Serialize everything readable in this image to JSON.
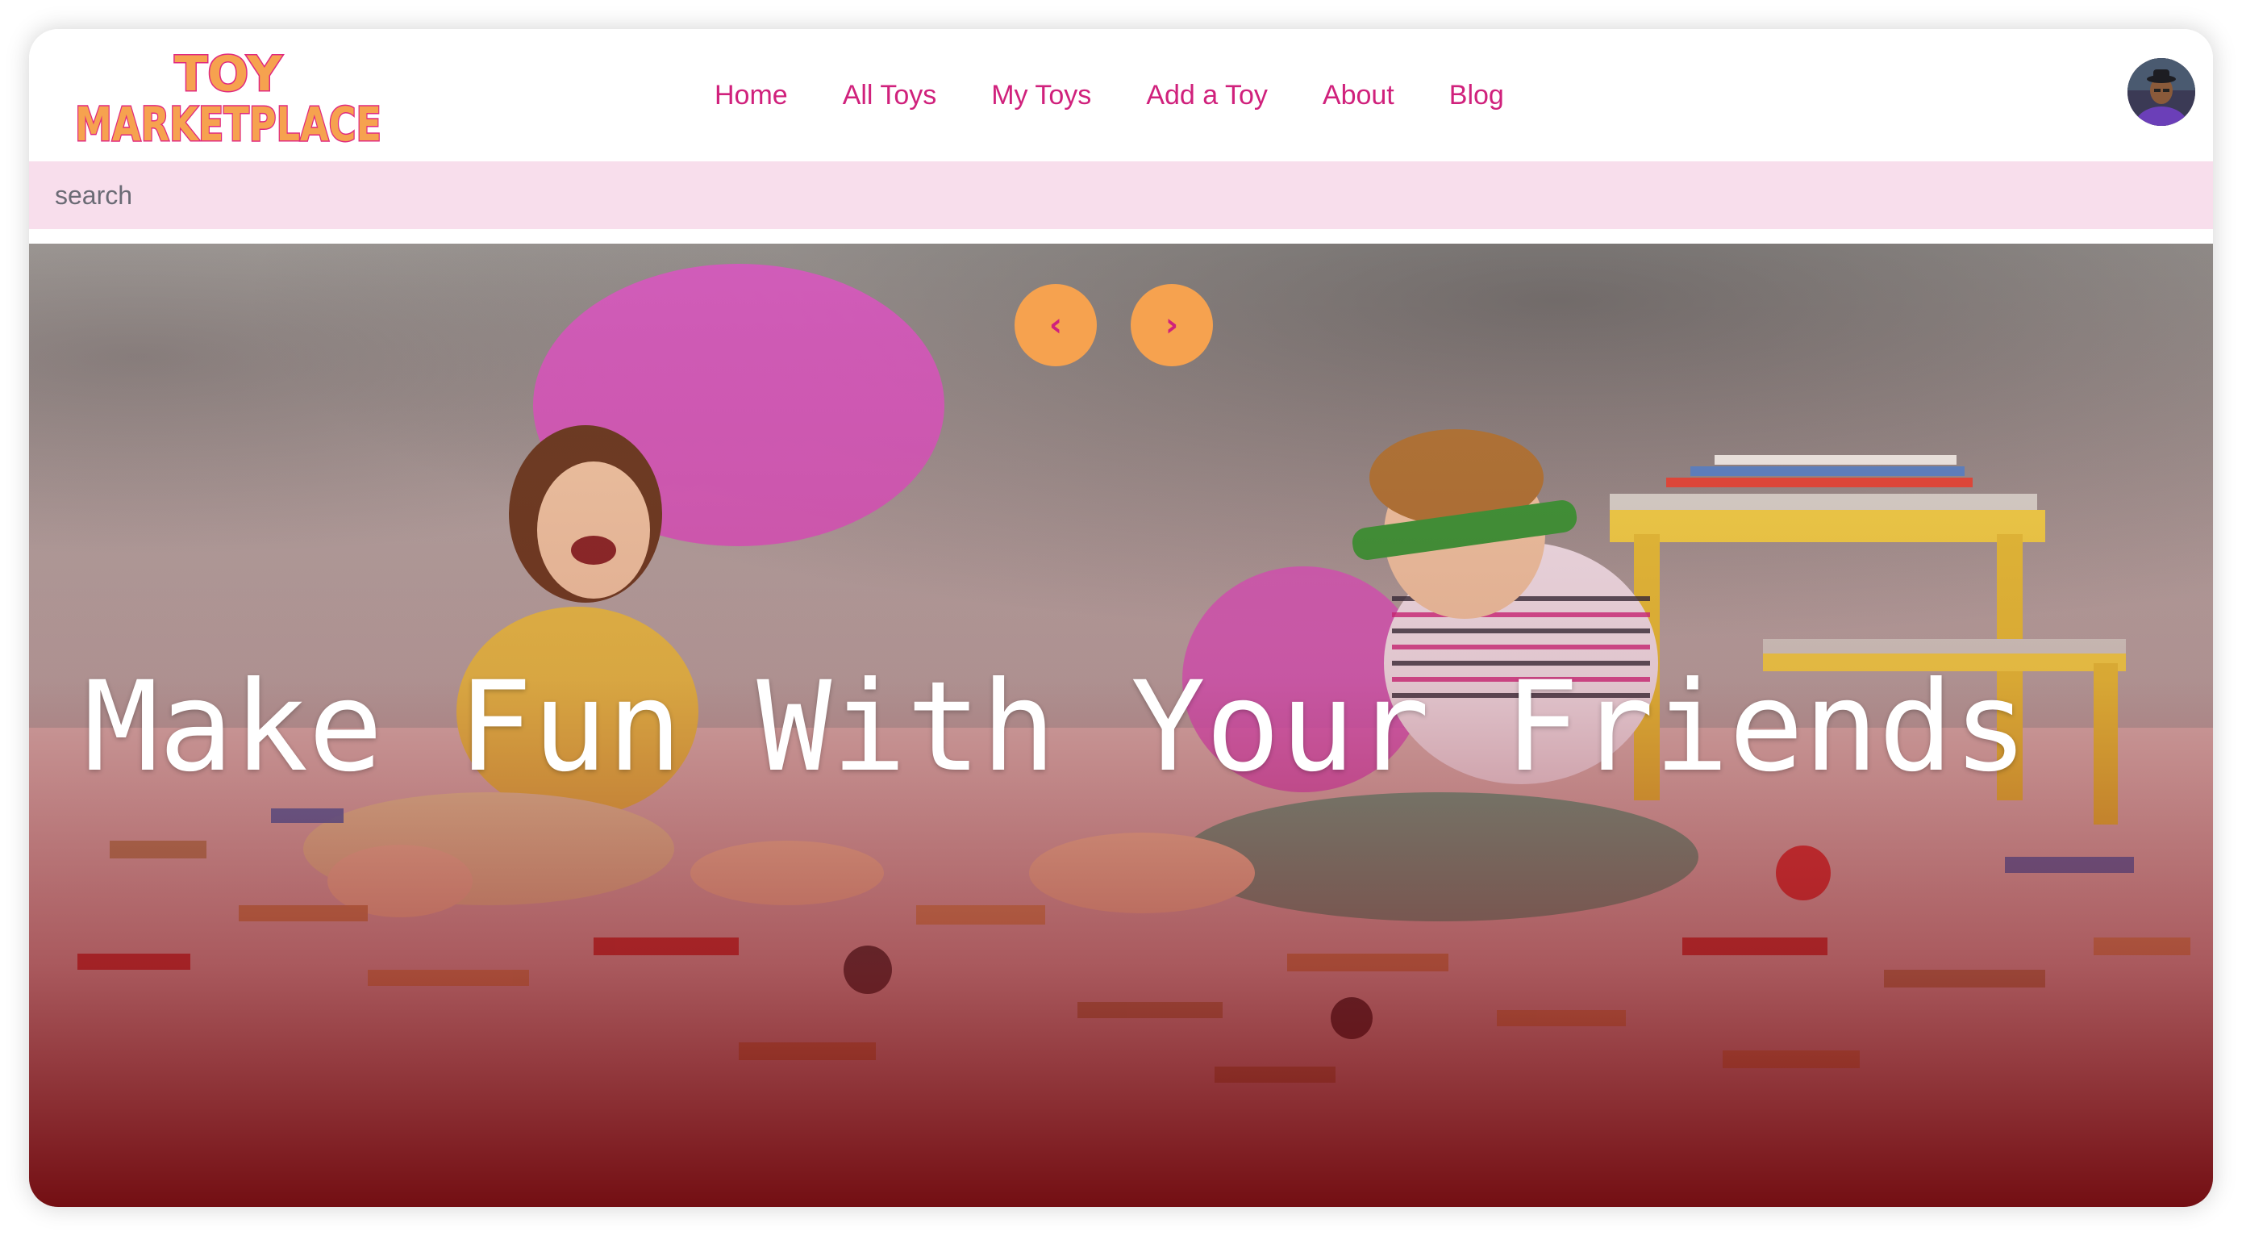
{
  "logo": {
    "line1": "TOY",
    "line2": "MARKETPLACE",
    "colors": {
      "fill": "#f6a24f",
      "outline": "#e0287f"
    }
  },
  "nav": {
    "items": [
      {
        "label": "Home"
      },
      {
        "label": "All Toys"
      },
      {
        "label": "My Toys"
      },
      {
        "label": "Add a Toy"
      },
      {
        "label": "About"
      },
      {
        "label": "Blog"
      }
    ],
    "color": "#d0217c"
  },
  "search": {
    "placeholder": "search",
    "value": ""
  },
  "hero": {
    "heading": "Make Fun With Your Friends",
    "prev_icon": "‹",
    "next_icon": "›",
    "colors": {
      "button": "#f6a24f",
      "arrow": "#d0217c",
      "overlay": "#7a0a12"
    }
  },
  "user": {
    "avatar_icon": "user-avatar-icon"
  }
}
